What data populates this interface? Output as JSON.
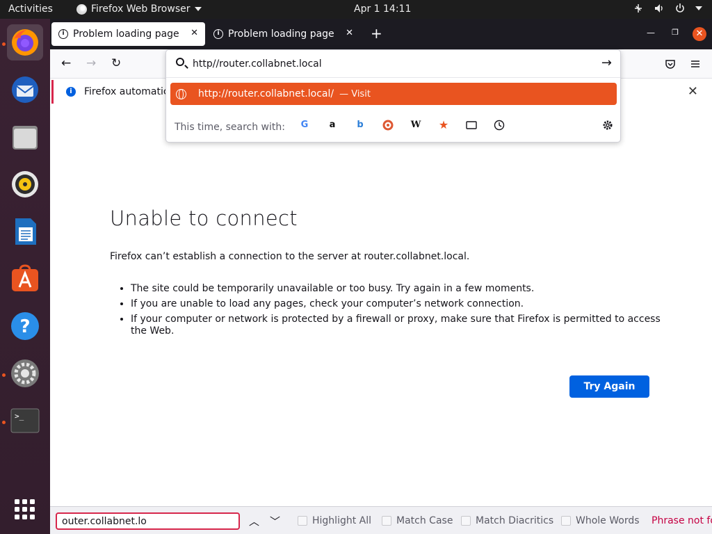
{
  "topbar": {
    "activities": "Activities",
    "app_name": "Firefox Web Browser",
    "clock": "Apr 1  14:11"
  },
  "dock": {
    "items": [
      "firefox",
      "thunderbird",
      "files",
      "rhythmbox",
      "libreoffice-writer",
      "ubuntu-software",
      "help",
      "settings",
      "terminal",
      "show-apps"
    ]
  },
  "tabs": [
    {
      "title": "Problem loading page"
    },
    {
      "title": "Problem loading page"
    }
  ],
  "infobar": {
    "text": "Firefox automatica"
  },
  "urlbar": {
    "value": "http//router.collabnet.local",
    "result_url": "http://router.collabnet.local/",
    "result_action": "— Visit",
    "search_with_label": "This time, search with:",
    "engines": [
      "Google",
      "Amazon",
      "Bing",
      "DuckDuckGo",
      "Wikipedia",
      "Bookmarks",
      "Tabs",
      "History"
    ]
  },
  "error": {
    "title": "Unable to connect",
    "description": "Firefox can’t establish a connection to the server at router.collabnet.local.",
    "bullets": [
      "The site could be temporarily unavailable or too busy. Try again in a few moments.",
      "If you are unable to load any pages, check your computer’s network connection.",
      "If your computer or network is protected by a firewall or proxy, make sure that Firefox is permitted to access the Web."
    ],
    "button": "Try Again"
  },
  "findbar": {
    "value": "outer.collabnet.lo",
    "options": [
      "Highlight All",
      "Match Case",
      "Match Diacritics",
      "Whole Words"
    ],
    "status": "Phrase not fo"
  },
  "colors": {
    "accent_orange": "#e95420",
    "firefox_blue": "#0061e0",
    "error_red": "#d7264b"
  }
}
